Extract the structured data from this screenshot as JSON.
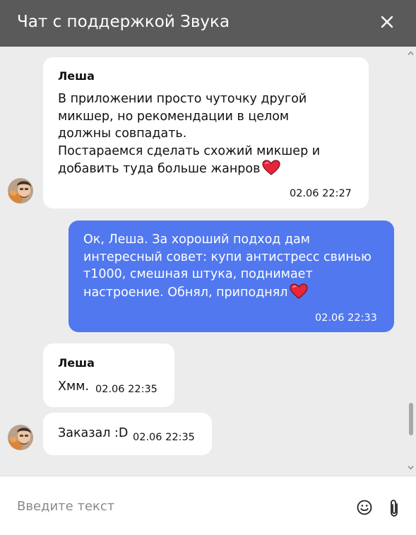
{
  "header": {
    "title": "Чат с поддержкой Звука"
  },
  "messages": [
    {
      "author": "Леша",
      "lines": [
        "В приложении просто чуточку другой",
        "микшер, но рекомендации в целом",
        "должны совпадать.",
        "Постараемся сделать схожий микшер и",
        "добавить туда больше жанров"
      ],
      "time": "02.06 22:27",
      "emoji": "heart-emoji"
    },
    {
      "lines": [
        "Ок, Леша. За хороший подход дам",
        "интересный совет: купи антистресс свинью",
        "т1000, смешная штука, поднимает",
        "настроение. Обнял, приподнял"
      ],
      "time": "02.06 22:33",
      "emoji": "heart-emoji"
    },
    {
      "author": "Леша",
      "text": "Хмм.",
      "time": "02.06 22:35"
    },
    {
      "text": "Заказал :D",
      "time": "02.06 22:35"
    }
  ],
  "input": {
    "placeholder": "Введите текст"
  },
  "colors": {
    "header_bg": "#5a5a5a",
    "chat_bg": "#ececec",
    "own_bubble": "#5178ef",
    "heart": "#e8253a"
  }
}
